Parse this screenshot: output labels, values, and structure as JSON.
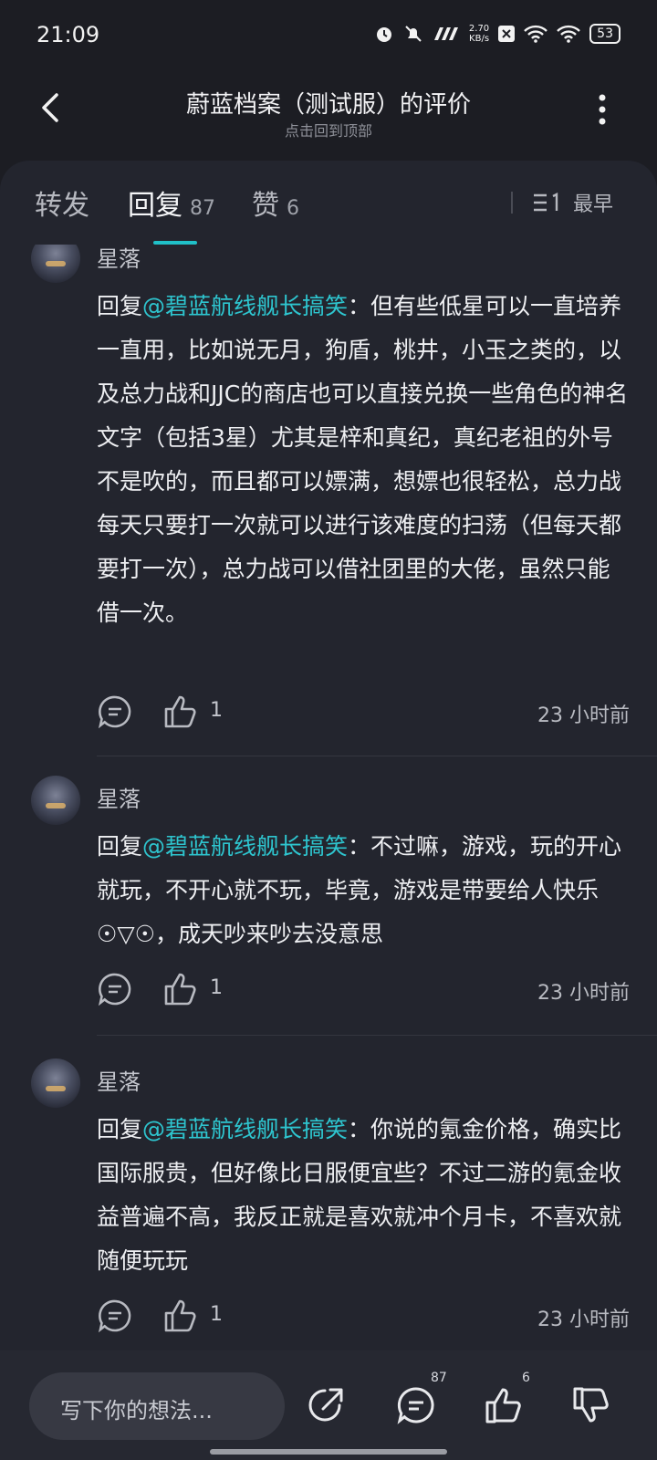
{
  "status": {
    "time": "21:09",
    "net_speed_value": "2.70",
    "net_speed_unit": "KB/s",
    "battery": "53"
  },
  "header": {
    "title": "蔚蓝档案（测试服）的评价",
    "subtitle": "点击回到顶部"
  },
  "tabs": {
    "forward": "转发",
    "reply": "回复",
    "reply_count": "87",
    "like": "赞",
    "like_count": "6",
    "sort_label": "最早"
  },
  "comments": [
    {
      "username": "星落",
      "reply_prefix": "回复",
      "mention": "@碧蓝航线舰长搞笑",
      "text": "：但有些低星可以一直培养一直用，比如说无月，狗盾，桃井，小玉之类的，以及总力战和JJC的商店也可以直接兑换一些角色的神名文字（包括3星）尤其是梓和真纪，真纪老祖的外号不是吹的，而且都可以嫖满，想嫖也很轻松，总力战每天只要打一次就可以进行该难度的扫荡（但每天都要打一次），总力战可以借社团里的大佬，虽然只能借一次。",
      "likes": "1",
      "time": "23 小时前"
    },
    {
      "username": "星落",
      "reply_prefix": "回复",
      "mention": "@碧蓝航线舰长搞笑",
      "text": "：不过嘛，游戏，玩的开心就玩，不开心就不玩，毕竟，游戏是带要给人快乐☉▽☉，成天吵来吵去没意思",
      "likes": "1",
      "time": "23 小时前"
    },
    {
      "username": "星落",
      "reply_prefix": "回复",
      "mention": "@碧蓝航线舰长搞笑",
      "text": "：你说的氪金价格，确实比国际服贵，但好像比日服便宜些？不过二游的氪金收益普遍不高，我反正就是喜欢就冲个月卡，不喜欢就随便玩玩",
      "likes": "1",
      "time": "23 小时前"
    }
  ],
  "bottom": {
    "input_placeholder": "写下你的想法...",
    "comment_count": "87",
    "like_count": "6"
  },
  "colors": {
    "accent": "#20c0c8",
    "background": "#1c1d23",
    "panel": "#23252e"
  }
}
